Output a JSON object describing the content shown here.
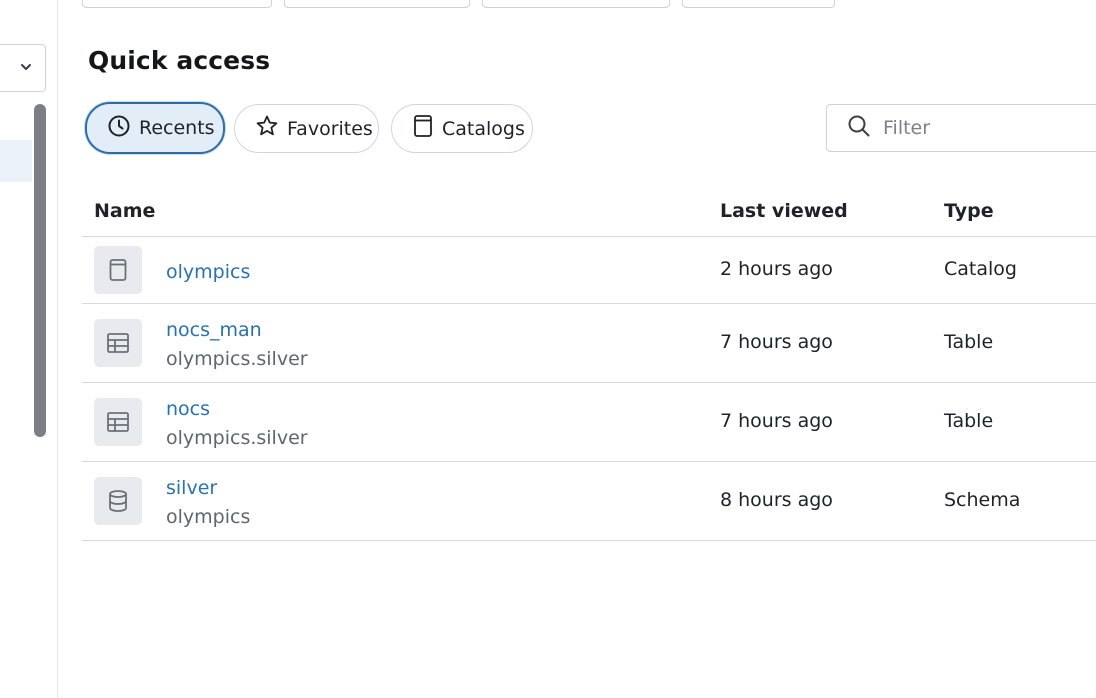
{
  "section": {
    "title": "Quick access"
  },
  "tabs": [
    {
      "label": "Recents",
      "icon": "clock-icon",
      "active": true
    },
    {
      "label": "Favorites",
      "icon": "star-icon",
      "active": false
    },
    {
      "label": "Catalogs",
      "icon": "catalog-icon",
      "active": false
    }
  ],
  "filter": {
    "placeholder": "Filter",
    "value": ""
  },
  "table": {
    "headers": {
      "name": "Name",
      "last_viewed": "Last viewed",
      "type": "Type"
    },
    "rows": [
      {
        "name": "olympics",
        "subtitle": "",
        "last_viewed": "2 hours ago",
        "type": "Catalog",
        "icon": "catalog-icon"
      },
      {
        "name": "nocs_man",
        "subtitle": "olympics.silver",
        "last_viewed": "7 hours ago",
        "type": "Table",
        "icon": "table-icon"
      },
      {
        "name": "nocs",
        "subtitle": "olympics.silver",
        "last_viewed": "7 hours ago",
        "type": "Table",
        "icon": "table-icon"
      },
      {
        "name": "silver",
        "subtitle": "olympics",
        "last_viewed": "8 hours ago",
        "type": "Schema",
        "icon": "schema-icon"
      }
    ]
  },
  "colors": {
    "link": "#2872b2",
    "active_tab_border": "#2e6ea6",
    "active_tab_bg": "#e3edf7",
    "icon_bg": "#e8eaed"
  }
}
